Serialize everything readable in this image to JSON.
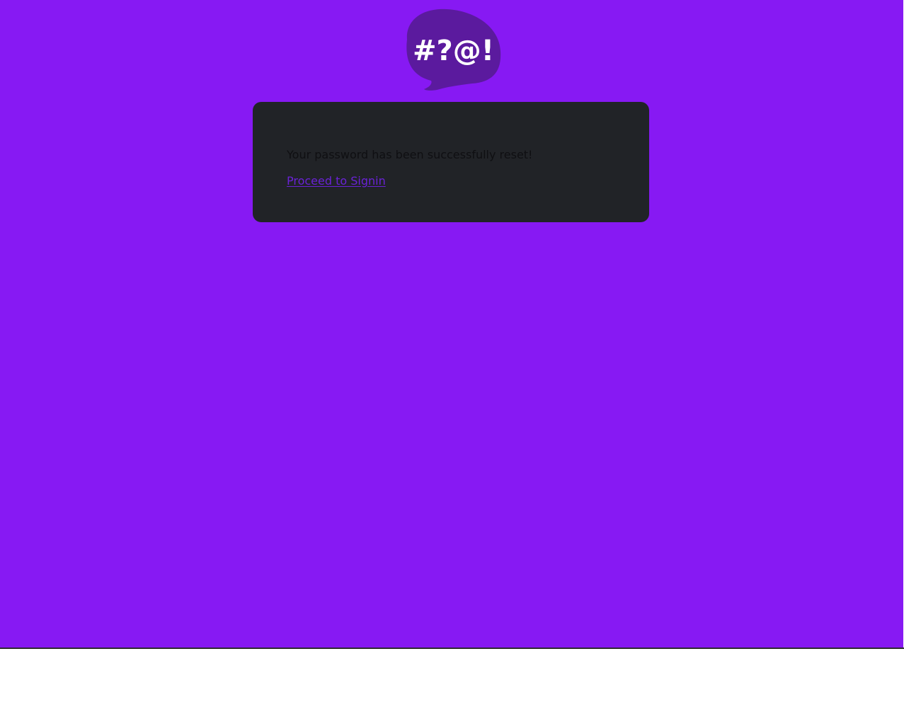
{
  "logo": {
    "icon": "speech-bubble-logo",
    "text": "#?@!",
    "bubble_color": "#5b1a9e",
    "text_color": "#ffffff"
  },
  "card": {
    "message": "Your password has been successfully reset!",
    "link_label": "Proceed to Signin"
  },
  "colors": {
    "background": "#8719f3",
    "card": "#212327",
    "link": "#6a22d6"
  }
}
